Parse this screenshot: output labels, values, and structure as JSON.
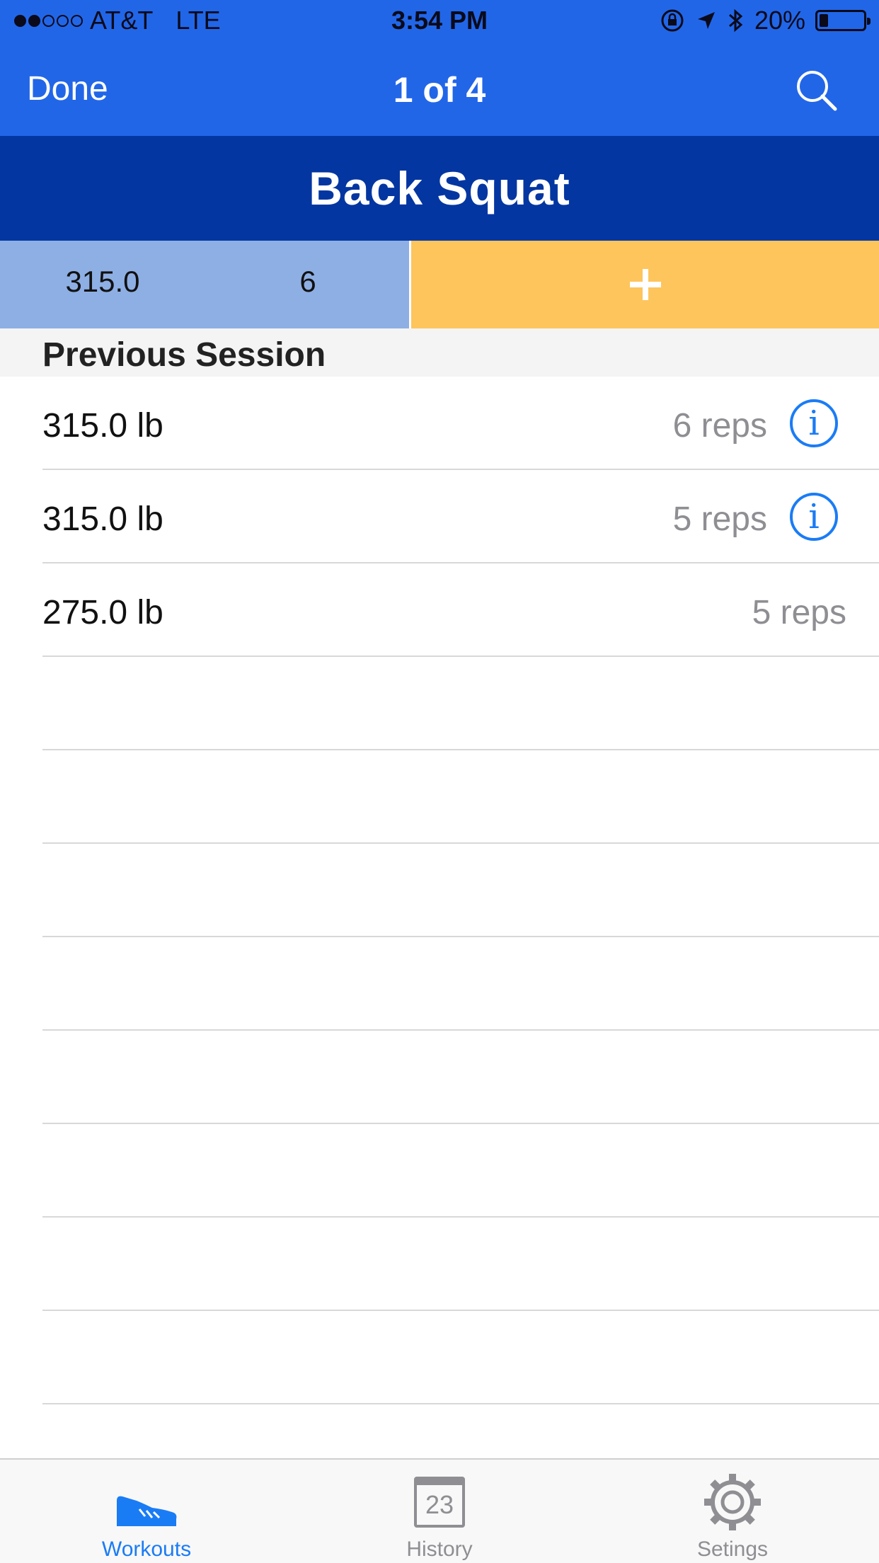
{
  "status_bar": {
    "carrier": "AT&T",
    "network": "LTE",
    "time": "3:54 PM",
    "battery_text": "20%",
    "battery_level": 0.2,
    "signal_bars_filled": 2,
    "signal_bars_total": 5,
    "icons": [
      "orientation-lock-icon",
      "location-arrow-icon",
      "bluetooth-icon",
      "battery-icon"
    ]
  },
  "nav": {
    "done_label": "Done",
    "title": "1 of 4",
    "search_icon": "search-icon"
  },
  "exercise": {
    "name": "Back Squat"
  },
  "entry": {
    "weight": "315.0",
    "reps": "6",
    "add_icon": "plus-icon"
  },
  "previous_session": {
    "title": "Previous Session",
    "sets": [
      {
        "weight": "315.0 lb",
        "reps": "6 reps",
        "has_info": true
      },
      {
        "weight": "315.0 lb",
        "reps": "5 reps",
        "has_info": true
      },
      {
        "weight": "275.0 lb",
        "reps": "5 reps",
        "has_info": false
      }
    ],
    "info_glyph": "i"
  },
  "tabs": [
    {
      "label": "Workouts",
      "icon": "sneaker-icon",
      "active": true
    },
    {
      "label": "History",
      "icon": "calendar-icon",
      "active": false,
      "calendar_day": "23"
    },
    {
      "label": "Setings",
      "icon": "gear-icon",
      "active": false
    }
  ],
  "colors": {
    "nav_blue": "#2266e8",
    "header_blue": "#0436a1",
    "entry_blue": "#8eafe4",
    "add_yellow": "#fdc55c",
    "tint": "#1a7cf5"
  }
}
